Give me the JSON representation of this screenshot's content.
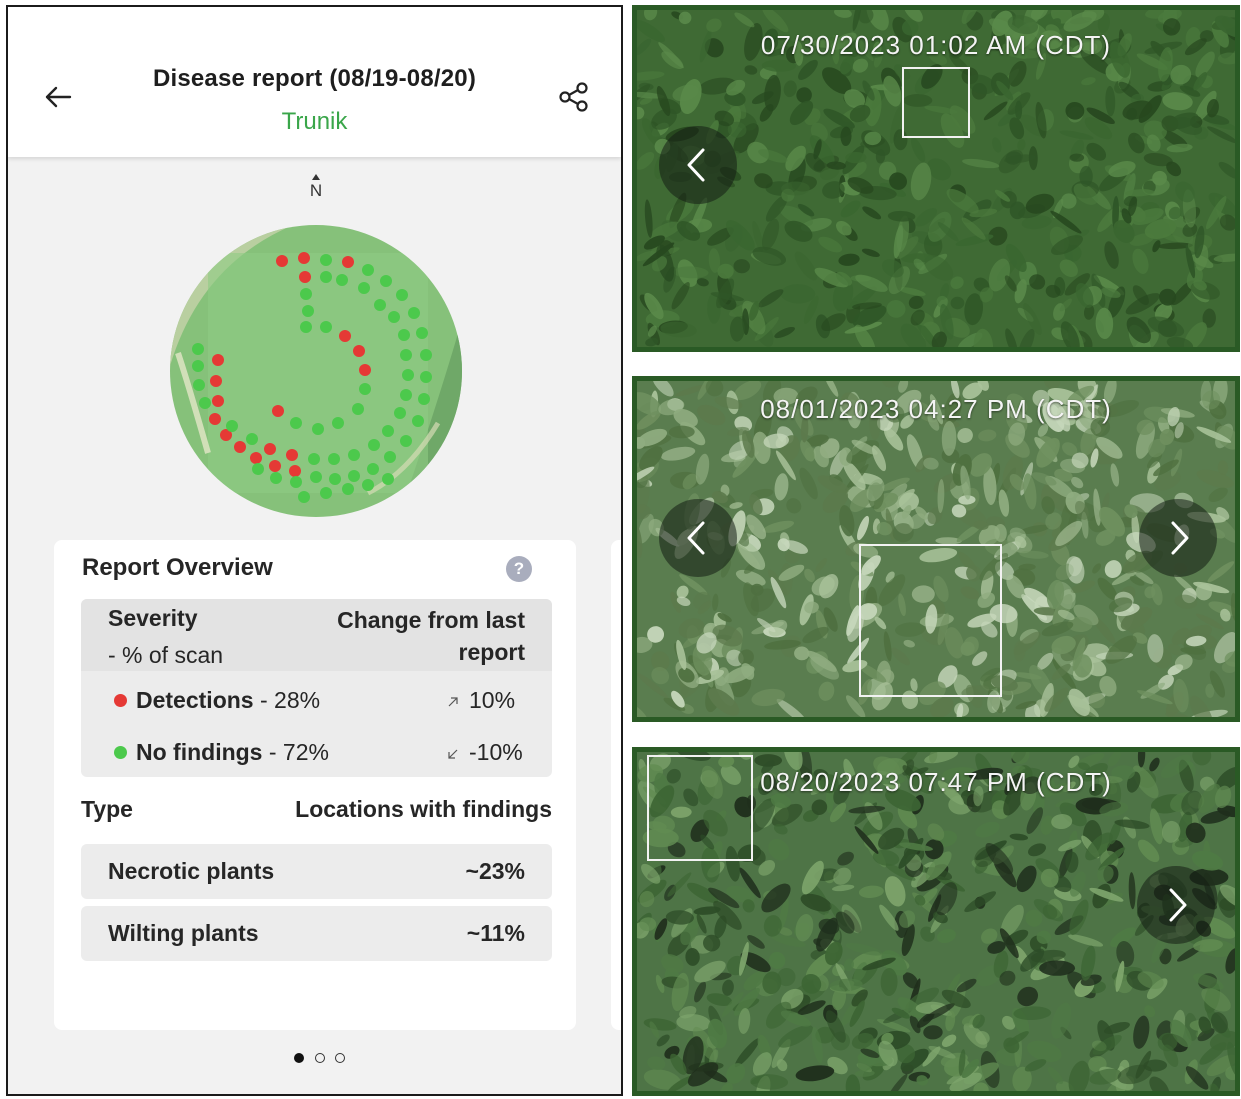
{
  "header": {
    "title": "Disease report (08/19-08/20)",
    "field_name": "Trunik",
    "back_icon": "arrow-left-icon",
    "share_icon": "share-icon"
  },
  "map": {
    "compass_label": "N",
    "detection_color": "#e53935",
    "no_findings_color": "#4cc94c"
  },
  "overview": {
    "title": "Report Overview",
    "help_label": "?",
    "severity_header": "Severity",
    "severity_subheader": "- % of scan",
    "change_header_line1": "Change from last",
    "change_header_line2": "report",
    "rows": [
      {
        "label": "Detections",
        "percent": " - 28%",
        "change": "10%",
        "direction": "up",
        "color": "#e53935"
      },
      {
        "label": "No findings",
        "percent": " - 72%",
        "change": "-10%",
        "direction": "down",
        "color": "#4cc94c"
      }
    ],
    "type_header": "Type",
    "locations_header": "Locations with findings",
    "types": [
      {
        "name": "Necrotic plants",
        "value": "~23%"
      },
      {
        "name": "Wilting plants",
        "value": "~11%"
      }
    ]
  },
  "pager": {
    "count": 3,
    "active": 0
  },
  "cameras": [
    {
      "timestamp": "07/30/2023 01:02 AM (CDT)",
      "has_prev": true,
      "has_next": false
    },
    {
      "timestamp": "08/01/2023 04:27 PM (CDT)",
      "has_prev": true,
      "has_next": true
    },
    {
      "timestamp": "08/20/2023 07:47 PM (CDT)",
      "has_prev": false,
      "has_next": true
    }
  ]
}
